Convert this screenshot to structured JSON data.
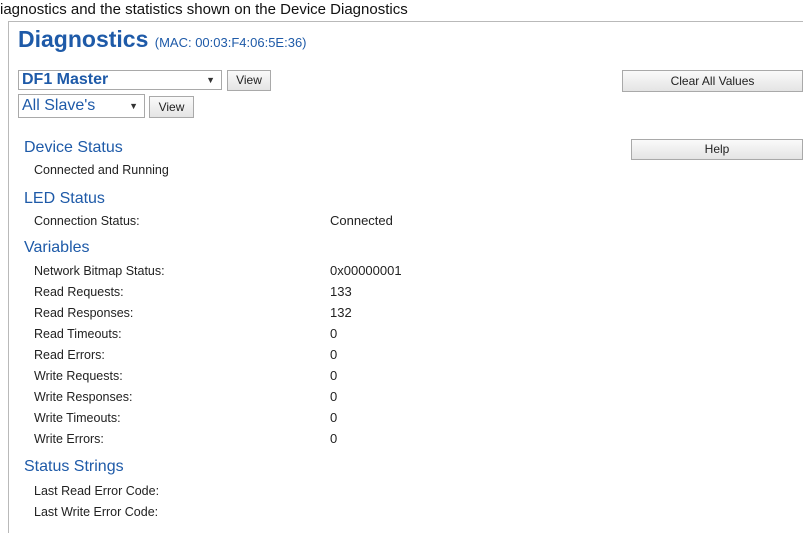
{
  "caption": "iagnostics and the statistics shown on the Device Diagnostics",
  "title": "Diagnostics",
  "mac": "(MAC: 00:03:F4:06:5E:36)",
  "protocol_select": {
    "value": "DF1 Master",
    "caret": "▼"
  },
  "protocol_view_label": "View",
  "slave_select": {
    "value": "All Slave's",
    "caret": "▼"
  },
  "slave_view_label": "View",
  "clear_all_label": "Clear All Values",
  "help_label": "Help",
  "device_status": {
    "heading": "Device Status",
    "text": "Connected and Running"
  },
  "led_status": {
    "heading": "LED Status",
    "rows": [
      {
        "label": "Connection Status:",
        "value": "Connected"
      }
    ]
  },
  "variables": {
    "heading": "Variables",
    "rows": [
      {
        "label": "Network Bitmap Status:",
        "value": "0x00000001"
      },
      {
        "label": "Read Requests:",
        "value": "133"
      },
      {
        "label": "Read Responses:",
        "value": "132"
      },
      {
        "label": "Read Timeouts:",
        "value": "0"
      },
      {
        "label": "Read Errors:",
        "value": "0"
      },
      {
        "label": "Write Requests:",
        "value": "0"
      },
      {
        "label": "Write Responses:",
        "value": "0"
      },
      {
        "label": "Write Timeouts:",
        "value": "0"
      },
      {
        "label": "Write Errors:",
        "value": "0"
      }
    ]
  },
  "status_strings": {
    "heading": "Status Strings",
    "rows": [
      {
        "label": "Last Read Error Code:",
        "value": ""
      },
      {
        "label": "Last Write Error Code:",
        "value": ""
      }
    ]
  }
}
